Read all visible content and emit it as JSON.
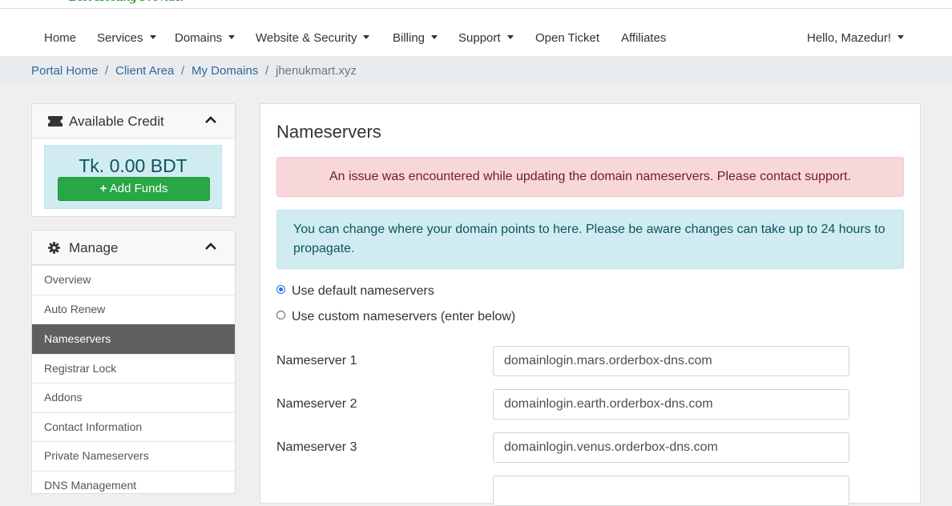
{
  "nav": {
    "items": [
      {
        "label": "Home",
        "dropdown": false
      },
      {
        "label": "Services",
        "dropdown": true
      },
      {
        "label": "Domains",
        "dropdown": true
      },
      {
        "label": "Website & Security",
        "dropdown": true
      },
      {
        "label": "Billing",
        "dropdown": true
      },
      {
        "label": "Support",
        "dropdown": true
      },
      {
        "label": "Open Ticket",
        "dropdown": false
      },
      {
        "label": "Affiliates",
        "dropdown": false
      }
    ],
    "user_greeting": "Hello, Mazedur!"
  },
  "breadcrumb": {
    "items": [
      "Portal Home",
      "Client Area",
      "My Domains"
    ],
    "separator": "/",
    "active": "jhenukmart.xyz"
  },
  "credit_panel": {
    "title": "Available Credit",
    "amount": "Tk. 0.00 BDT",
    "add_funds_label": "Add Funds"
  },
  "manage_panel": {
    "title": "Manage",
    "items": [
      "Overview",
      "Auto Renew",
      "Nameservers",
      "Registrar Lock",
      "Addons",
      "Contact Information",
      "Private Nameservers",
      "DNS Management"
    ],
    "active_index": 2
  },
  "main": {
    "title": "Nameservers",
    "error_message": "An issue was encountered while updating the domain nameservers. Please contact support.",
    "info_message": "You can change where your domain points to here. Please be aware changes can take up to 24 hours to propagate.",
    "radio_default": "Use default nameservers",
    "radio_custom": "Use custom nameservers (enter below)",
    "selected_radio": "default",
    "nameservers": [
      {
        "label": "Nameserver 1",
        "value": "domainlogin.mars.orderbox-dns.com"
      },
      {
        "label": "Nameserver 2",
        "value": "domainlogin.earth.orderbox-dns.com"
      },
      {
        "label": "Nameserver 3",
        "value": "domainlogin.venus.orderbox-dns.com"
      }
    ]
  },
  "colors": {
    "accent_link": "#336699",
    "success": "#28a745",
    "danger_bg": "#f8d7da",
    "info_bg": "#d1ecf1",
    "active_menu_bg": "#5f5f5f"
  }
}
